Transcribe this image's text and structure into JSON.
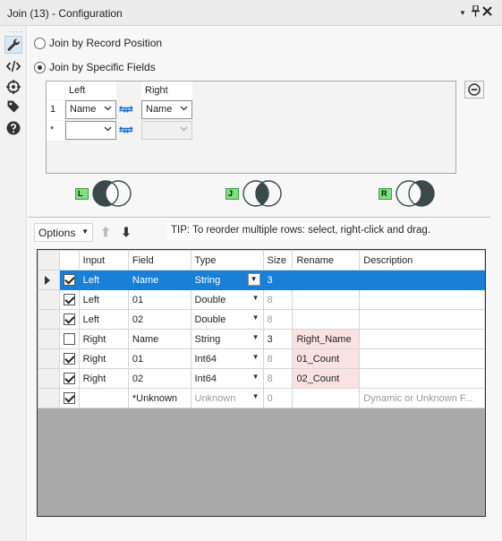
{
  "window": {
    "title": "Join (13) - Configuration",
    "dropdown_glyph": "▾",
    "pin_glyph": "📌",
    "close_glyph": "✕"
  },
  "rail": {
    "icons": [
      "wrench-icon",
      "code-icon",
      "crosshair-icon",
      "tag-icon",
      "help-icon"
    ],
    "active": "wrench-icon",
    "status_icon": "check-circle-icon"
  },
  "join_mode": {
    "options": [
      {
        "label": "Join by Record Position",
        "selected": false
      },
      {
        "label": "Join by Specific Fields",
        "selected": true
      }
    ]
  },
  "join_fields": {
    "left_header": "Left",
    "right_header": "Right",
    "rows": [
      {
        "num": "1",
        "left": "Name",
        "right": "Name"
      },
      {
        "num": "*",
        "left": "",
        "right": ""
      }
    ]
  },
  "venn": {
    "left_tag": "L",
    "join_tag": "J",
    "right_tag": "R",
    "fill_color": "#3a4a4a"
  },
  "toolbar": {
    "options_label": "Options",
    "up_glyph": "⬆",
    "down_glyph": "⬇",
    "tip": "TIP: To reorder multiple rows: select, right-click and drag."
  },
  "grid": {
    "columns": [
      "Input",
      "Field",
      "Type",
      "Size",
      "Rename",
      "Description"
    ],
    "rows": [
      {
        "checked": true,
        "input": "Left",
        "field": "Name",
        "type": "String",
        "size": "3",
        "rename": "",
        "description": "",
        "selected": true
      },
      {
        "checked": true,
        "input": "Left",
        "field": "01",
        "type": "Double",
        "size": "8",
        "rename": "",
        "description": ""
      },
      {
        "checked": true,
        "input": "Left",
        "field": "02",
        "type": "Double",
        "size": "8",
        "rename": "",
        "description": ""
      },
      {
        "checked": false,
        "input": "Right",
        "field": "Name",
        "type": "String",
        "size": "3",
        "rename": "Right_Name",
        "description": ""
      },
      {
        "checked": true,
        "input": "Right",
        "field": "01",
        "type": "Int64",
        "size": "8",
        "rename": "01_Count",
        "description": ""
      },
      {
        "checked": true,
        "input": "Right",
        "field": "02",
        "type": "Int64",
        "size": "8",
        "rename": "02_Count",
        "description": ""
      },
      {
        "checked": true,
        "input": "",
        "field": "*Unknown",
        "type": "Unknown",
        "size": "0",
        "rename": "",
        "description": "Dynamic or Unknown F..."
      }
    ],
    "selection_color": "#1a7fd6",
    "rename_highlight": "#fbe2e2"
  }
}
